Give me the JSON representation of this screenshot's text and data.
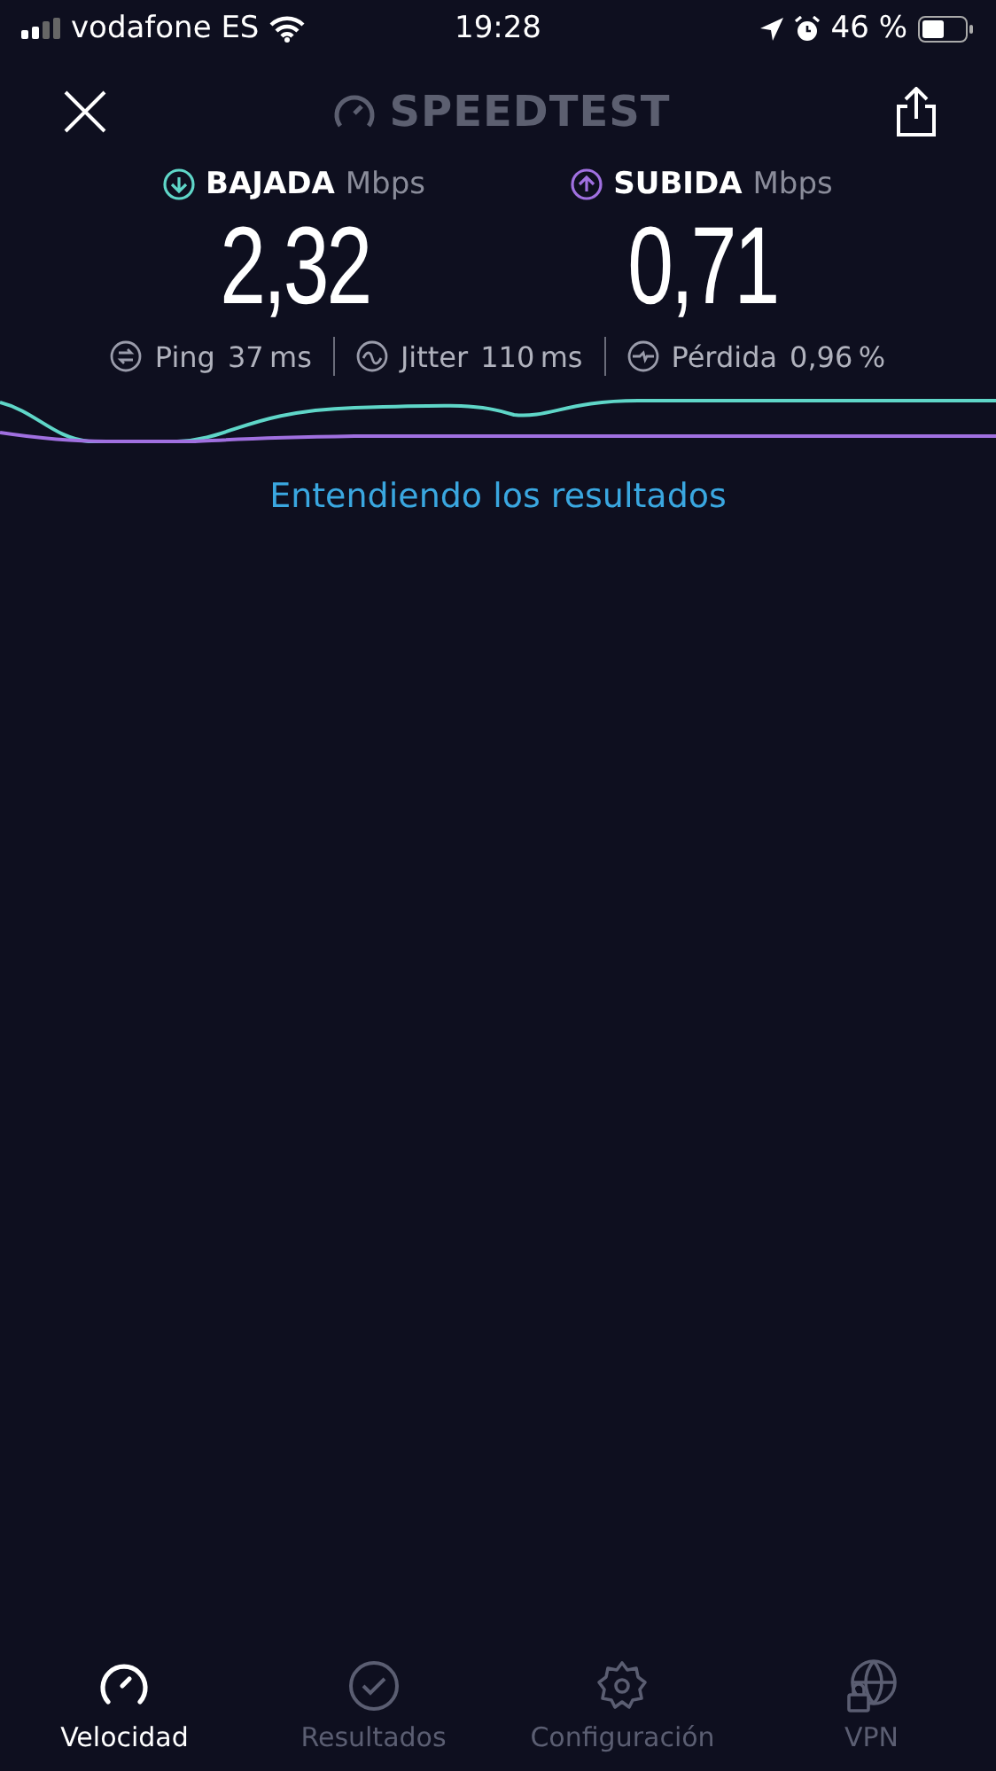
{
  "status_bar": {
    "carrier": "vodafone ES",
    "time": "19:28",
    "battery": "46 %"
  },
  "header": {
    "logo": "SPEEDTEST"
  },
  "speeds": [
    {
      "kind": "download",
      "label": "BAJADA",
      "unit": "Mbps",
      "value": "2,32"
    },
    {
      "kind": "upload",
      "label": "SUBIDA",
      "unit": "Mbps",
      "value": "0,71"
    }
  ],
  "metrics": [
    {
      "kind": "ping",
      "label": "Ping",
      "value": "37",
      "unit": "ms"
    },
    {
      "kind": "jitter",
      "label": "Jitter",
      "value": "110",
      "unit": "ms"
    },
    {
      "kind": "loss",
      "label": "Pérdida",
      "value": "0,96",
      "unit": "%"
    }
  ],
  "link": "Entendiendo los resultados",
  "tabs": [
    {
      "kind": "speed",
      "label": "Velocidad",
      "selected": true
    },
    {
      "kind": "results",
      "label": "Resultados",
      "selected": false
    },
    {
      "kind": "settings",
      "label": "Configuración",
      "selected": false
    },
    {
      "kind": "vpn",
      "label": "VPN",
      "selected": false
    }
  ]
}
